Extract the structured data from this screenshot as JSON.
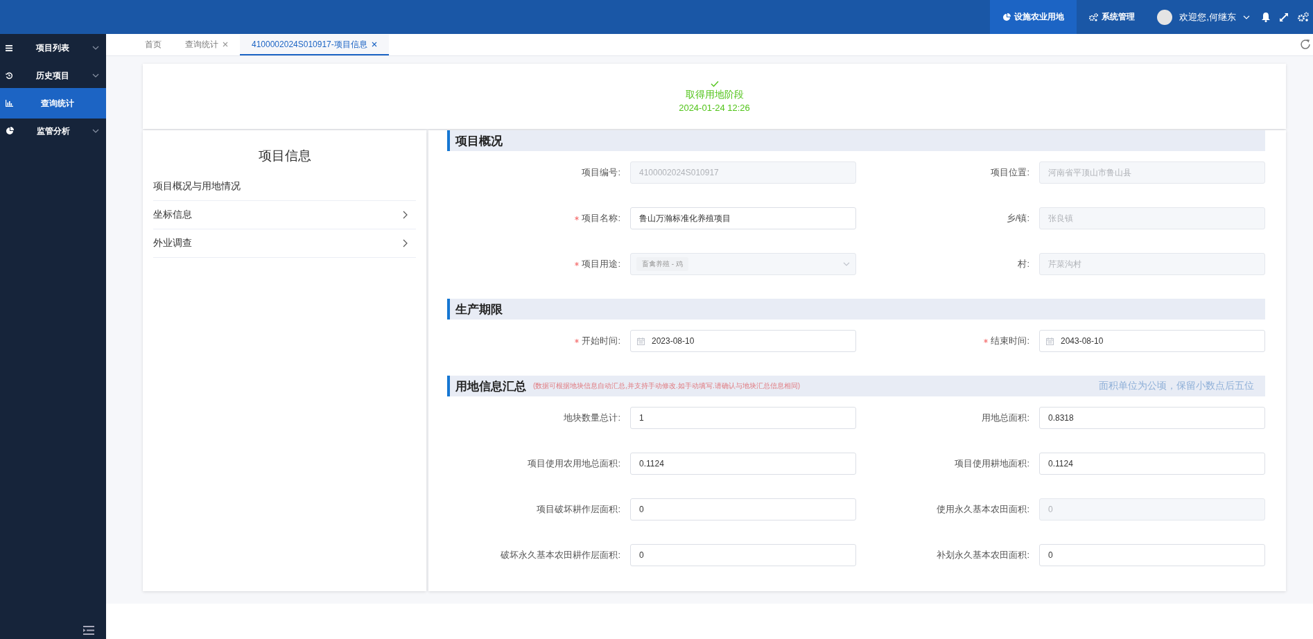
{
  "topbar": {
    "nav": [
      {
        "label": "设施农业用地",
        "selected": true
      },
      {
        "label": "系统管理",
        "selected": false
      }
    ],
    "user": {
      "greeting": "欢迎您,何继东"
    }
  },
  "sidebar": {
    "items": [
      {
        "label": "项目列表",
        "expandable": true,
        "selected": false
      },
      {
        "label": "历史项目",
        "expandable": true,
        "selected": false
      },
      {
        "label": "查询统计",
        "expandable": false,
        "selected": true
      },
      {
        "label": "监管分析",
        "expandable": true,
        "selected": false
      }
    ]
  },
  "tabs": [
    {
      "label": "首页",
      "closable": false,
      "selected": false
    },
    {
      "label": "查询统计",
      "closable": true,
      "selected": false
    },
    {
      "label": "4100002024S010917-项目信息",
      "closable": true,
      "selected": true
    }
  ],
  "status": {
    "title": "取得用地阶段",
    "date": "2024-01-24 12:26"
  },
  "info_panel": {
    "title": "项目信息",
    "items": [
      {
        "label": "项目概况与用地情况",
        "expandable": false
      },
      {
        "label": "坐标信息",
        "expandable": true
      },
      {
        "label": "外业调查",
        "expandable": true
      }
    ]
  },
  "sections": [
    {
      "title": "项目概况",
      "fields": [
        {
          "label": "项目编号:",
          "kind": "text",
          "value": "4100002024S010917",
          "required": false,
          "disabled": true
        },
        {
          "label": "项目位置:",
          "kind": "text",
          "value": "河南省平顶山市鲁山县",
          "required": false,
          "disabled": true
        },
        {
          "label": "项目名称:",
          "kind": "text",
          "value": "鲁山万瀚标准化养殖项目",
          "required": true,
          "disabled": false
        },
        {
          "label": "乡/镇:",
          "kind": "text",
          "value": "张良镇",
          "required": false,
          "disabled": true
        },
        {
          "label": "项目用途:",
          "kind": "select",
          "value": "畜禽养殖 - 鸡",
          "required": true,
          "disabled": true
        },
        {
          "label": "村:",
          "kind": "text",
          "value": "芹菜沟村",
          "required": false,
          "disabled": true
        }
      ]
    },
    {
      "title": "生产期限",
      "fields": [
        {
          "label": "开始时间:",
          "kind": "date",
          "value": "2023-08-10",
          "required": true,
          "disabled": false
        },
        {
          "label": "结束时间:",
          "kind": "date",
          "value": "2043-08-10",
          "required": true,
          "disabled": false
        }
      ]
    },
    {
      "title": "用地信息汇总",
      "note": "(数据可根据地块信息自动汇总,并支持手动修改.如手动填写.请确认与地块汇总信息相同)",
      "hint": "面积单位为公顷，保留小数点后五位",
      "fields": [
        {
          "label": "地块数量总计:",
          "kind": "text",
          "value": "1",
          "required": false,
          "disabled": false
        },
        {
          "label": "用地总面积:",
          "kind": "text",
          "value": "0.8318",
          "required": false,
          "disabled": false
        },
        {
          "label": "项目使用农用地总面积:",
          "kind": "text",
          "value": "0.1124",
          "required": false,
          "disabled": false
        },
        {
          "label": "项目使用耕地面积:",
          "kind": "text",
          "value": "0.1124",
          "required": false,
          "disabled": false
        },
        {
          "label": "项目破坏耕作层面积:",
          "kind": "text",
          "value": "0",
          "required": false,
          "disabled": false
        },
        {
          "label": "使用永久基本农田面积:",
          "kind": "text",
          "value": "0",
          "required": false,
          "disabled": true
        },
        {
          "label": "破坏永久基本农田耕作层面积:",
          "kind": "text",
          "value": "0",
          "required": false,
          "disabled": false
        },
        {
          "label": "补划永久基本农田面积:",
          "kind": "text",
          "value": "0",
          "required": false,
          "disabled": false
        }
      ]
    }
  ]
}
